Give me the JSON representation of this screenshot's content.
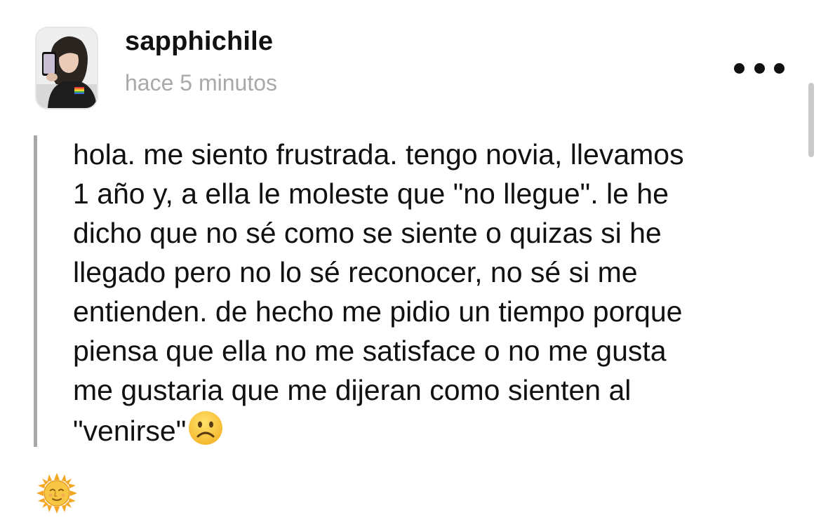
{
  "post": {
    "username": "sapphichile",
    "timestamp": "hace 5 minutos",
    "avatar_icon": "profile-photo",
    "more_icon": "more-horizontal-icon",
    "body_lines": [
      "hola. me siento frustrada. tengo novia, llevamos",
      "1 año y, a ella le moleste que \"no llegue\". le he",
      "dicho que no sé como se siente o quizas si he",
      "llegado pero no lo sé reconocer, no sé si me",
      "entienden. de hecho me pidio un tiempo porque",
      "piensa que ella no me satisface o no me gusta",
      "me gustaria que me dijeran como sienten al",
      "\"venirse\""
    ],
    "trailing_emoji": "frowning-face-emoji",
    "reaction_emoji": "sun-with-face-emoji"
  },
  "colors": {
    "text": "#111111",
    "muted": "#a9a9a9",
    "quote_bar": "#a8a8a8",
    "scrollbar": "#c9c9c9",
    "emoji_yellow": "#f5b82e"
  }
}
